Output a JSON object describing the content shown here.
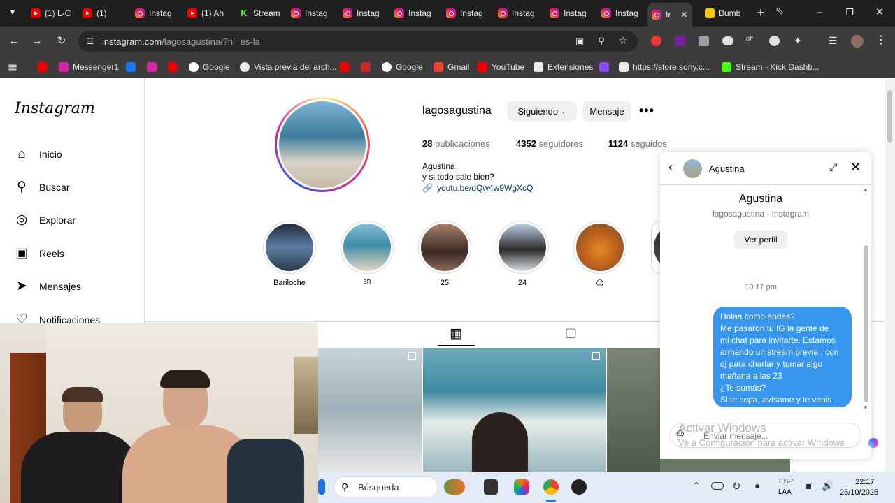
{
  "browser": {
    "tabs": [
      {
        "label": "(1) L-C",
        "icon": "youtube-icon"
      },
      {
        "label": "(1)",
        "icon": "youtube-icon"
      },
      {
        "label": "Instag",
        "icon": "instagram-icon"
      },
      {
        "label": "(1) Ah",
        "icon": "youtube-icon"
      },
      {
        "label": "Stream",
        "icon": "kick-icon"
      },
      {
        "label": "Instag",
        "icon": "instagram-icon"
      },
      {
        "label": "Instag",
        "icon": "instagram-icon"
      },
      {
        "label": "Instag",
        "icon": "instagram-icon"
      },
      {
        "label": "Instag",
        "icon": "instagram-icon"
      },
      {
        "label": "Instag",
        "icon": "instagram-icon"
      },
      {
        "label": "Instag",
        "icon": "instagram-icon"
      },
      {
        "label": "Instag",
        "icon": "instagram-icon"
      },
      {
        "label": "Ir",
        "icon": "instagram-icon"
      },
      {
        "label": "Bumb",
        "icon": "bumble-icon"
      }
    ],
    "url_host": "instagram.com",
    "url_path": "/lagosagustina/?hl=es-la",
    "bookmarks": [
      {
        "label": "",
        "icon": "youtube-icon"
      },
      {
        "label": "Messenger1",
        "icon": "instagram-icon"
      },
      {
        "label": "",
        "icon": "facebook-icon"
      },
      {
        "label": "",
        "icon": "instagram-icon"
      },
      {
        "label": "",
        "icon": "youtube-icon"
      },
      {
        "label": "Google",
        "icon": "google-icon"
      },
      {
        "label": "Vista previa del arch...",
        "icon": "globe-icon"
      },
      {
        "label": "",
        "icon": "youtube-icon"
      },
      {
        "label": "",
        "icon": "red-icon"
      },
      {
        "label": "Google",
        "icon": "google-icon"
      },
      {
        "label": "Gmail",
        "icon": "gmail-icon"
      },
      {
        "label": "YouTube",
        "icon": "youtube-icon"
      },
      {
        "label": "Extensiones",
        "icon": "puzzle-icon"
      },
      {
        "label": "",
        "icon": "twitch-icon"
      },
      {
        "label": "https://store.sony.c...",
        "icon": "playstation-icon"
      },
      {
        "label": "Stream - Kick Dashb...",
        "icon": "kick-icon"
      }
    ]
  },
  "sidebar": {
    "logo": "Instagram",
    "items": [
      {
        "label": "Inicio",
        "icon": "home-icon"
      },
      {
        "label": "Buscar",
        "icon": "search-icon"
      },
      {
        "label": "Explorar",
        "icon": "compass-icon"
      },
      {
        "label": "Reels",
        "icon": "reels-icon"
      },
      {
        "label": "Mensajes",
        "icon": "send-icon"
      },
      {
        "label": "Notificaciones",
        "icon": "heart-icon"
      }
    ]
  },
  "profile": {
    "username": "lagosagustina",
    "following_button": "Siguiendo",
    "message_button": "Mensaje",
    "posts_count": "28",
    "posts_label": "publicaciones",
    "followers_count": "4352",
    "followers_label": "seguidores",
    "following_count": "1124",
    "following_label": "seguidos",
    "name": "Agustina",
    "bio": "y si todo sale bien?",
    "link": "youtu.be/dQw4w9WgXcQ",
    "highlights": [
      "Bariloche",
      "BR",
      "25",
      "24",
      "😉"
    ]
  },
  "dm": {
    "header_name": "Agustina",
    "profile_name": "Agustina",
    "profile_sub": "lagosagustina · Instagram",
    "view_profile": "Ver perfil",
    "timestamp": "10:17 pm",
    "message_lines": [
      "Holaa como andas?",
      "Me pasaron tu IG la gente de",
      "mi chat para invitarte. Estamos",
      "armando un stream previa , con",
      "dj  para charlar y tomar algo",
      "mañana a las 23",
      "¿Te sumás?",
      "Si te copa, avísame y te venis"
    ],
    "input_placeholder": "Enviar mensaje..."
  },
  "watermark": {
    "title": "Activar Windows",
    "sub": "Ve a Configuración para activar Windows."
  },
  "taskbar": {
    "search": "Búsqueda",
    "lang1": "ESP",
    "lang2": "LAA",
    "time": "22:17",
    "date": "26/10/2025"
  }
}
